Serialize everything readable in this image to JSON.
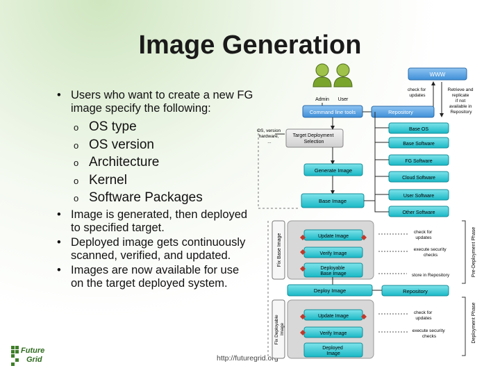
{
  "slide": {
    "title": "Image Generation",
    "footer": "http://futuregrid.org",
    "logo_text": [
      "Future",
      "Grid"
    ]
  },
  "bullets": {
    "intro": "Users who want to create a new FG image specify the following:",
    "subitems": [
      "OS type",
      "OS version",
      "Architecture",
      "Kernel",
      "Software Packages"
    ],
    "after": [
      "Image is generated, then deployed to specified target.",
      "Deployed image gets continuously scanned, verified, and updated.",
      "Images are now available for use on the target deployed system."
    ]
  },
  "diagram": {
    "actors": [
      "Admin",
      "User"
    ],
    "www": "WWW",
    "check_for_updates_top": [
      "check for",
      "updates"
    ],
    "retrieve_note": [
      "Retrieve and",
      "replicate",
      "if not",
      "available in",
      "Repository"
    ],
    "command_line_tools": "Command line tools",
    "repository_top": "Repository",
    "os_note": [
      "OS, version",
      "hardware,",
      "..."
    ],
    "target_selection": [
      "Target Deployment",
      "Selection"
    ],
    "generate_image": "Generate Image",
    "base_image": "Base Image",
    "repo_list": [
      "Base OS",
      "Base Software",
      "FG Software",
      "Cloud Software",
      "User Software",
      "Other Software"
    ],
    "fix_base_image": "Fix Base Image",
    "update_image": "Update Image",
    "verify_image": "Verify Image",
    "deployable_base_image": [
      "Deployable",
      "Base Image"
    ],
    "pre_notes": {
      "check_updates": [
        "check for",
        "updates"
      ],
      "security_checks": [
        "execute security",
        "checks"
      ],
      "store_repo": "store in Repository"
    },
    "pre_phase": "Pre-Deployment Phase",
    "deploy_image": "Deploy Image",
    "repository_mid": "Repository",
    "fix_deployable_image": [
      "Fix Deployable",
      "Image"
    ],
    "update_image_2": "Update Image",
    "verify_image_2": "Verify Image",
    "deployed_image": [
      "Deployed",
      "Image"
    ],
    "dep_notes": {
      "check_updates": [
        "check for",
        "updates"
      ],
      "security_checks": [
        "execute security",
        "checks"
      ]
    },
    "dep_phase": "Deployment Phase"
  }
}
